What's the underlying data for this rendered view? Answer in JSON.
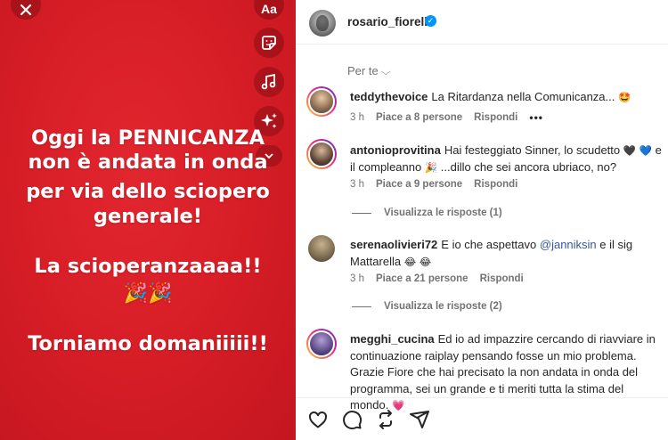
{
  "story": {
    "line1": "Oggi la PENNICANZA",
    "line2": "non è andata in onda",
    "line3": "per via dello sciopero",
    "line4": "generale!",
    "line5": "La scioperanzaaaa!!",
    "line6": "🎉🎉",
    "line7": "Torniamo domaniiiii!!",
    "aa_label": "Aa",
    "background": "#d81e27"
  },
  "header": {
    "username": "rosario_fiorello",
    "verified_mark": "✓"
  },
  "sort": {
    "label": "Per te"
  },
  "comments": [
    {
      "username": "teddythevoice",
      "text": "La Ritardanza nella Comunicanza...",
      "emoji": "🤩",
      "time": "3 h",
      "likes": "Piace a 8 persone",
      "reply": "Rispondi",
      "more": "•••"
    },
    {
      "username": "antonioprovitina",
      "text_a": "Hai festeggiato Sinner, lo scudetto ",
      "emoji_a": "🖤 💙",
      "text_b": " e il compleanno ",
      "emoji_b": "🎉",
      "text_c": " ...dillo che sei ancora ubriaco, no?",
      "time": "3 h",
      "likes": "Piace a 9 persone",
      "reply": "Rispondi",
      "view_replies": "Visualizza le risposte (1)"
    },
    {
      "username": "serenaolivieri72",
      "text_a": "E io che aspettavo ",
      "mention": "@janniksin",
      "text_b": " e il sig Mattarella ",
      "emoji": "😂 😂",
      "time": "3 h",
      "likes": "Piace a 21 persone",
      "reply": "Rispondi",
      "view_replies": "Visualizza le risposte (2)"
    },
    {
      "username": "megghi_cucina",
      "text": "Ed io ad impazzire cercando di riavviare in continuazione raiplay pensando fosse un mio problema. Grazie Fiore che hai precisato la non andata in onda del programma, sei un grande e ti meriti tutta la stima del mondo.",
      "emoji": "💗"
    }
  ],
  "actions": [
    "heart-icon",
    "comment-icon",
    "repost-icon",
    "share-icon"
  ]
}
